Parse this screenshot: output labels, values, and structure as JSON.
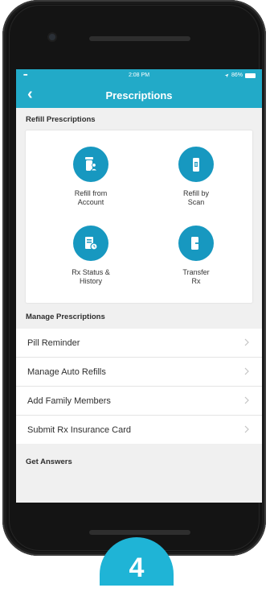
{
  "status_bar": {
    "signal": "▪▪▪",
    "time": "2:08 PM",
    "battery_percent": "86%"
  },
  "nav": {
    "back_glyph": "‹",
    "title": "Prescriptions"
  },
  "refill": {
    "header": "Refill Prescriptions",
    "tiles": [
      {
        "line1": "Refill from",
        "line2": "Account",
        "icon": "bottle-person-icon"
      },
      {
        "line1": "Refill by",
        "line2": "Scan",
        "icon": "bottle-scan-icon"
      },
      {
        "line1": "Rx Status &",
        "line2": "History",
        "icon": "rx-status-clock-icon"
      },
      {
        "line1": "Transfer",
        "line2": "Rx",
        "icon": "transfer-rx-icon"
      }
    ]
  },
  "manage": {
    "header": "Manage Prescriptions",
    "items": [
      {
        "label": "Pill Reminder"
      },
      {
        "label": "Manage Auto Refills"
      },
      {
        "label": "Add Family Members"
      },
      {
        "label": "Submit Rx Insurance Card"
      }
    ]
  },
  "answers": {
    "header": "Get Answers"
  },
  "step_badge": {
    "number": "4"
  },
  "colors": {
    "accent": "#22aac8",
    "icon_circle": "#1798c0",
    "badge": "#1fb4d6",
    "background": "#f0f0f0"
  }
}
